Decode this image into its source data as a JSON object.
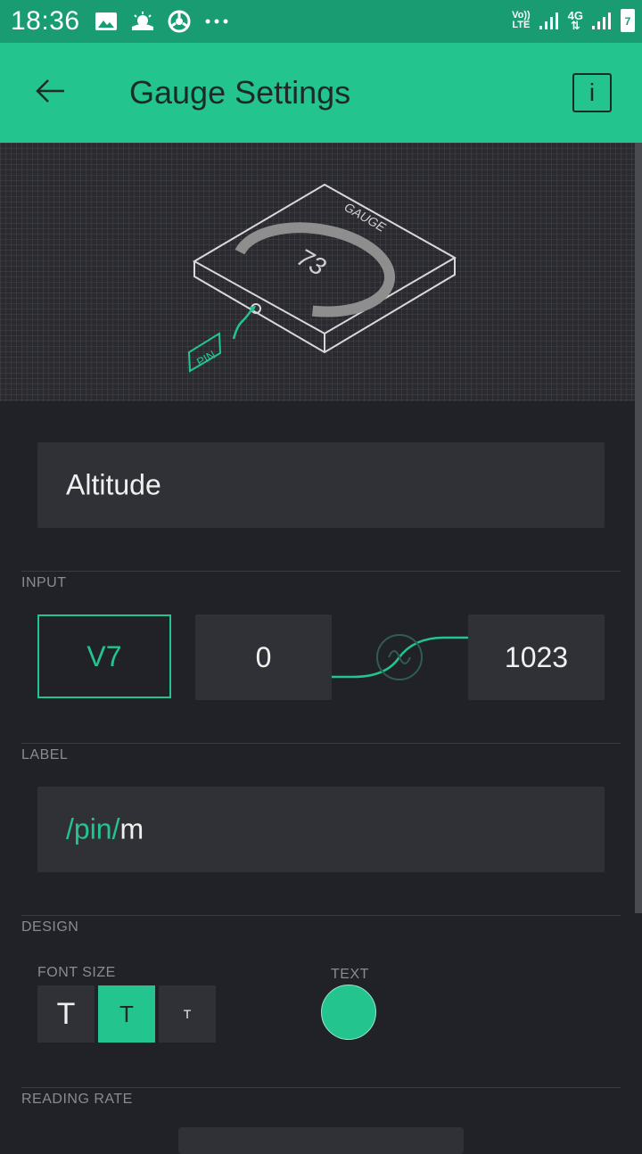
{
  "status_bar": {
    "time": "18:36",
    "left_icons": [
      "image-icon",
      "weather-icon",
      "chrome-icon",
      "more-icon"
    ],
    "volte_label": "Vo))\nLTE",
    "network_label": "4G",
    "battery_level": "7"
  },
  "app_bar": {
    "title": "Gauge Settings",
    "info_label": "i"
  },
  "preview": {
    "gauge_word": "GAUGE",
    "gauge_value": "73",
    "pin_word": "PIN"
  },
  "name_field": {
    "value": "Altitude"
  },
  "input_section": {
    "label": "INPUT",
    "pin": "V7",
    "min": "0",
    "max": "1023"
  },
  "label_section": {
    "label": "LABEL",
    "value_pin_part": "/pin/",
    "value_suffix": "m"
  },
  "design_section": {
    "label": "DESIGN",
    "font_size_label": "FONT SIZE",
    "font_sizes": [
      {
        "label": "T",
        "selected": false
      },
      {
        "label": "T",
        "selected": true
      },
      {
        "label": "T",
        "selected": false
      }
    ],
    "text_color_label": "TEXT",
    "text_color": "#23c48e"
  },
  "reading_rate_section": {
    "label": "READING RATE"
  },
  "colors": {
    "accent": "#23c48e",
    "status_bar": "#1a9c72",
    "background": "#212227"
  }
}
